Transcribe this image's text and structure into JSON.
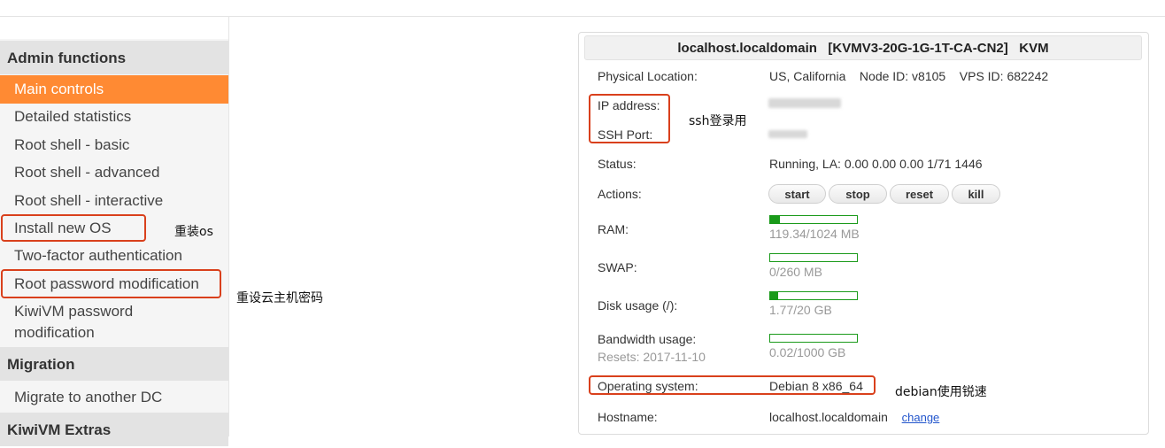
{
  "sidebar": {
    "admin_heading": "Admin functions",
    "items": [
      {
        "label": "Main controls"
      },
      {
        "label": "Detailed statistics"
      },
      {
        "label": "Root shell - basic"
      },
      {
        "label": "Root shell - advanced"
      },
      {
        "label": "Root shell - interactive"
      },
      {
        "label": "Install new OS"
      },
      {
        "label": "Two-factor authentication"
      },
      {
        "label": "Root password modification"
      },
      {
        "label": "KiwiVM password modification"
      }
    ],
    "migration_heading": "Migration",
    "migration_items": [
      {
        "label": "Migrate to another DC"
      }
    ],
    "extras_heading": "KiwiVM Extras",
    "active_item": "Main controls",
    "accent_color": "#ff8a33"
  },
  "annotations": {
    "install_os": "重装os",
    "root_password": "重设云主机密码",
    "ssh": "ssh登录用",
    "os": "debian使用锐速",
    "box_color": "#d9401c"
  },
  "panel": {
    "title": "localhost.localdomain   [KVMV3-20G-1G-1T-CA-CN2]   KVM",
    "physical_location": {
      "label": "Physical Location:",
      "value": "US, California    Node ID: v8105    VPS ID: 682242"
    },
    "ip_address": {
      "label": "IP address:"
    },
    "ssh_port": {
      "label": "SSH Port:"
    },
    "status": {
      "label": "Status:",
      "value": "Running, LA: 0.00 0.00 0.00 1/71 1446"
    },
    "actions": {
      "label": "Actions:",
      "buttons": [
        "start",
        "stop",
        "reset",
        "kill"
      ]
    },
    "ram": {
      "label": "RAM:",
      "value": "119.34/1024 MB",
      "fraction": 0.1166
    },
    "swap": {
      "label": "SWAP:",
      "value": "0/260 MB",
      "fraction": 0
    },
    "disk": {
      "label": "Disk usage (/):",
      "value": "1.77/20 GB",
      "fraction": 0.0885
    },
    "bandwidth": {
      "label": "Bandwidth usage:",
      "resets": "Resets: 2017-11-10",
      "value": "0.02/1000 GB",
      "fraction": 2e-05
    },
    "os": {
      "label": "Operating system:",
      "value": "Debian 8 x86_64"
    },
    "hostname": {
      "label": "Hostname:",
      "value": "localhost.localdomain",
      "change_link": "change"
    },
    "bar_color": "#1a9a1a"
  }
}
